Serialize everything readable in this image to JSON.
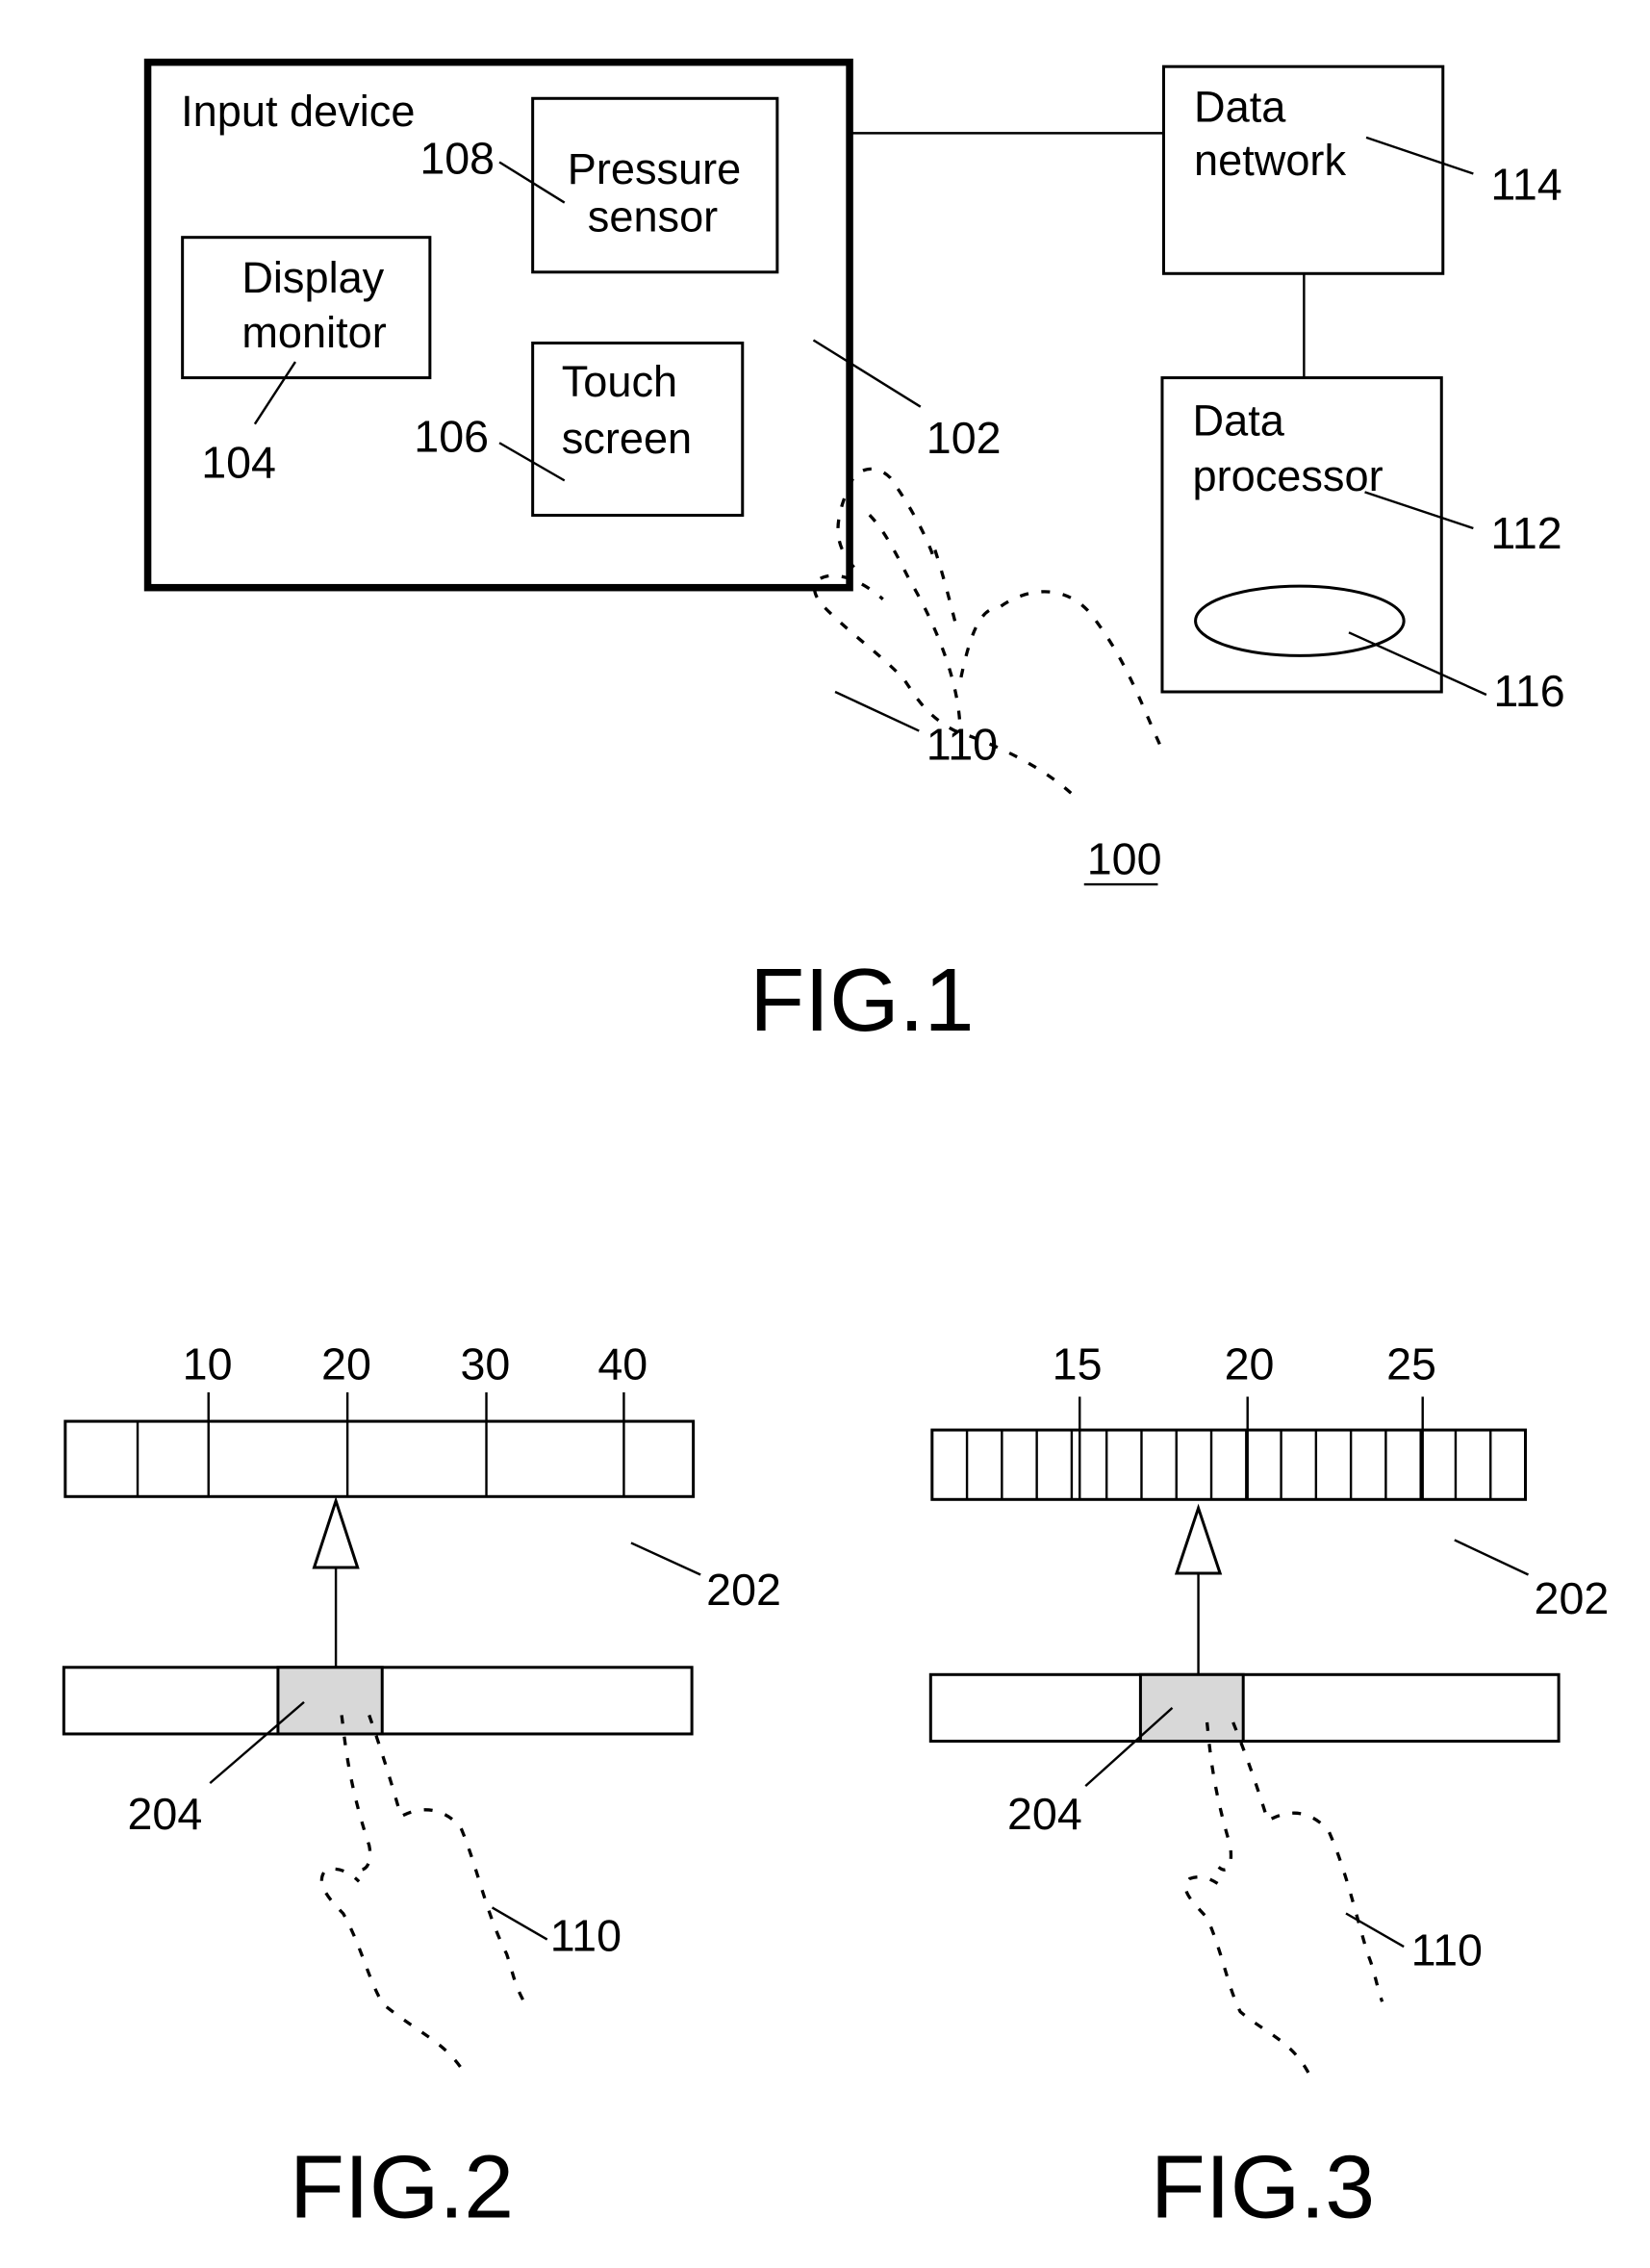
{
  "fig1": {
    "caption": "FIG.1",
    "system_ref": "100",
    "input_device": {
      "label": "Input device",
      "ref": "102"
    },
    "pressure_sensor": {
      "line1": "Pressure",
      "line2": "sensor",
      "ref": "108"
    },
    "display_monitor": {
      "line1": "Display",
      "line2": "monitor",
      "ref": "104"
    },
    "touch_screen": {
      "line1": "Touch",
      "line2": "screen",
      "ref": "106"
    },
    "finger_ref": "110",
    "data_network": {
      "line1": "Data",
      "line2": "network",
      "ref": "114"
    },
    "data_processor": {
      "line1": "Data",
      "line2": "processor",
      "ref": "112"
    },
    "storage_ref": "116"
  },
  "fig2": {
    "caption": "FIG.2",
    "scale_labels": [
      "10",
      "20",
      "30",
      "40"
    ],
    "scale_ref": "202",
    "slider_ref": "204",
    "finger_ref": "110"
  },
  "fig3": {
    "caption": "FIG.3",
    "scale_labels": [
      "15",
      "20",
      "25"
    ],
    "scale_ref": "202",
    "slider_ref": "204",
    "finger_ref": "110"
  }
}
